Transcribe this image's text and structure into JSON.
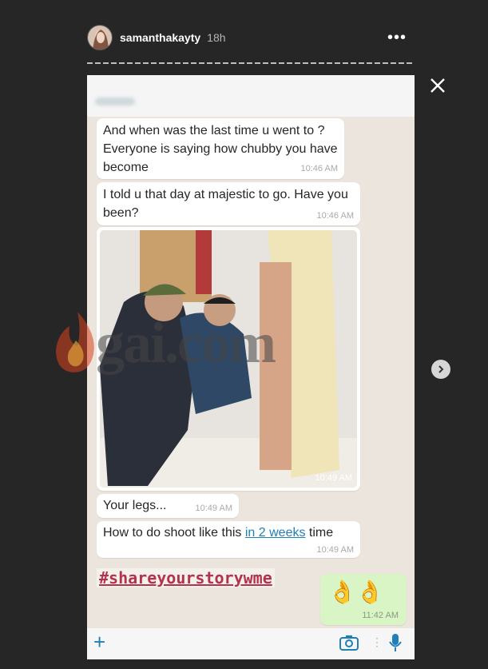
{
  "header": {
    "username": "samanthakayty",
    "time": "18h"
  },
  "story": {
    "messages": [
      {
        "text": "And when was the last time u went to  ? Everyone is saying how chubby you have become",
        "time": "10:46 AM"
      },
      {
        "text": "I told u that day at majestic to go. Have you been?",
        "time": "10:46 AM"
      },
      {
        "time": "10:49 AM"
      },
      {
        "text": "Your legs...",
        "time": "10:49 AM"
      },
      {
        "text_before": "How to do shoot like this ",
        "link": "in 2 weeks",
        "text_after": " time",
        "time": "10:49 AM"
      }
    ],
    "hashtag": "#shareyourstorywme",
    "reply": {
      "emoji": "👌👌",
      "time": "11:42 AM"
    }
  },
  "watermark": "gai.com",
  "colors": {
    "background": "#262626",
    "chat_bg": "#ece5dd",
    "hashtag": "#b3334c",
    "link": "#1f7fb7"
  }
}
